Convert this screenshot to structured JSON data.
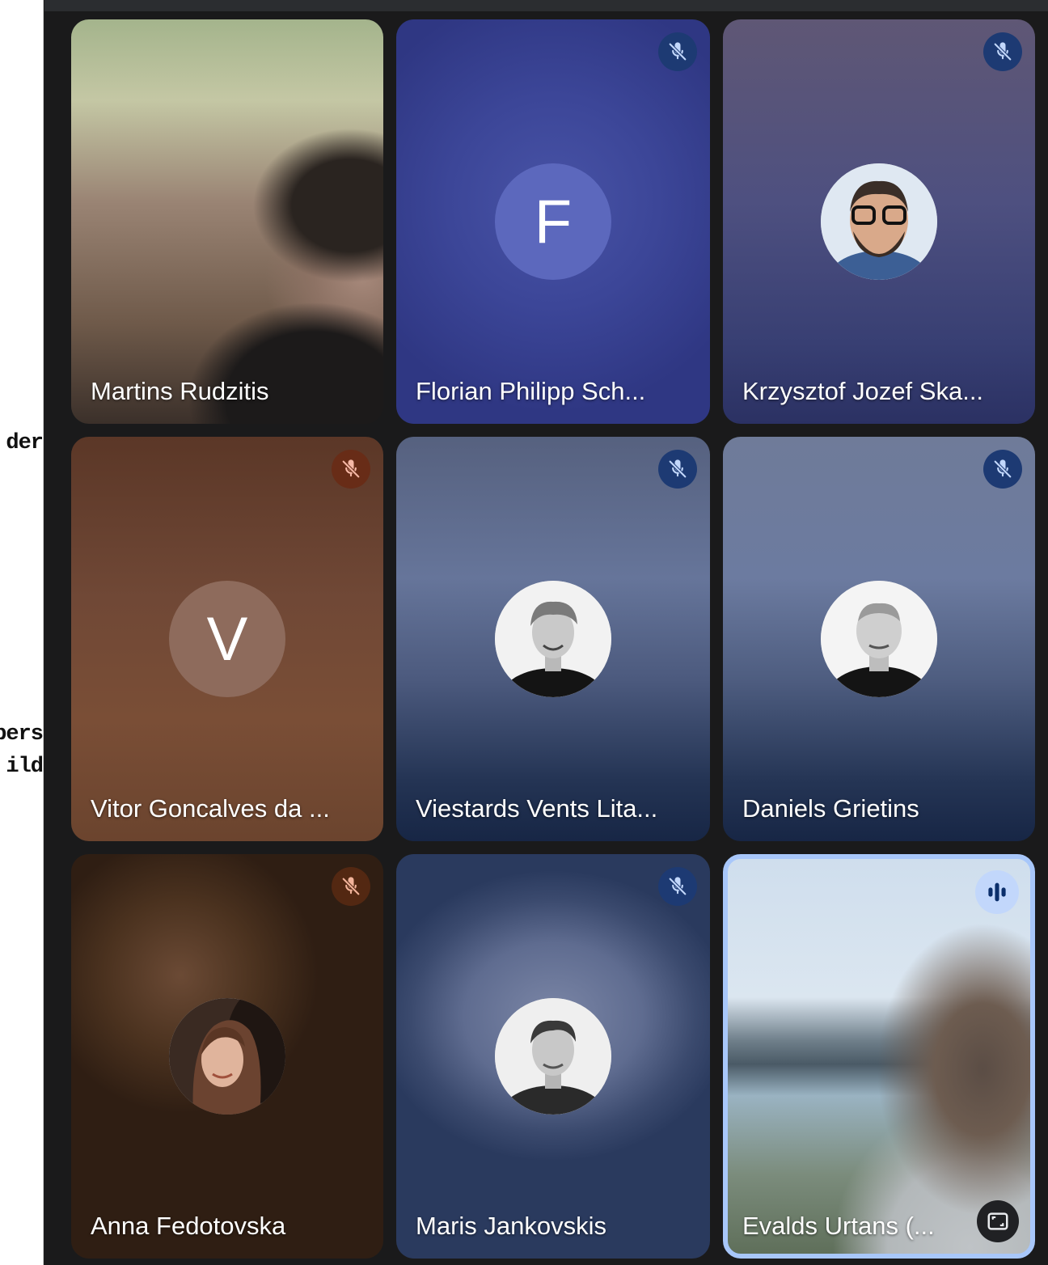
{
  "background_document": {
    "fragments": [
      "der",
      "pers",
      "ild"
    ]
  },
  "colors": {
    "active_speaker_border": "#a8c7fa",
    "mute_badge_blue": "#1d3a73",
    "mute_badge_brown": "#682c17",
    "name_text": "#ffffff"
  },
  "participants": [
    {
      "name": "Martins Rudzitis",
      "muted": false,
      "display": "video"
    },
    {
      "name": "Florian Philipp Sch...",
      "muted": true,
      "display": "initial",
      "avatar_initial": "F"
    },
    {
      "name": "Krzysztof Jozef Ska...",
      "muted": true,
      "display": "photo",
      "avatar_icon": "profile-photo"
    },
    {
      "name": "Vitor Goncalves da ...",
      "muted": true,
      "display": "initial",
      "avatar_initial": "V"
    },
    {
      "name": "Viestards Vents Lita...",
      "muted": true,
      "display": "photo",
      "avatar_icon": "profile-photo"
    },
    {
      "name": "Daniels Grietins",
      "muted": true,
      "display": "photo",
      "avatar_icon": "profile-photo"
    },
    {
      "name": "Anna Fedotovska",
      "muted": true,
      "display": "photo",
      "avatar_icon": "profile-photo"
    },
    {
      "name": "Maris Jankovskis",
      "muted": true,
      "display": "photo",
      "avatar_icon": "profile-photo"
    },
    {
      "name": "Evalds Urtans (...",
      "muted": false,
      "display": "video",
      "speaking": true,
      "active_speaker": true
    }
  ],
  "icons": {
    "mute": "mic-off-icon",
    "speaking": "audio-level-icon",
    "pin": "fullscreen-frame-icon"
  }
}
